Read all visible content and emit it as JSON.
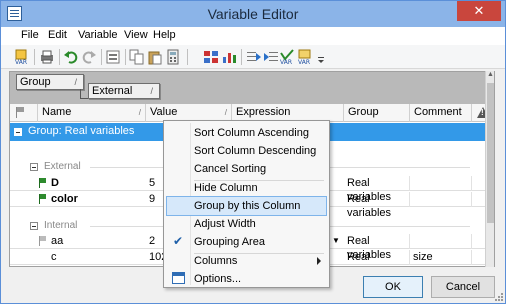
{
  "window": {
    "title": "Variable Editor",
    "close_glyph": "✕"
  },
  "menu": [
    "File",
    "Edit",
    "Variable",
    "View",
    "Help"
  ],
  "group_panel": {
    "chips": [
      "Group",
      "External"
    ],
    "sort_glyph": "/"
  },
  "columns": [
    "Name",
    "Value",
    "Expression",
    "Group",
    "Comment"
  ],
  "group_row": {
    "label": "Group: Real variables"
  },
  "subgroups": {
    "external": "External",
    "internal": "Internal"
  },
  "rows": [
    {
      "name": "D",
      "value": "5",
      "group": "Real variables",
      "comment": ""
    },
    {
      "name": "color",
      "value": "9",
      "group": "Real variables",
      "comment": ""
    },
    {
      "name": "aa",
      "value": "2",
      "group": "Real variables",
      "comment": ""
    },
    {
      "name": "c",
      "value": "102",
      "group": "Real variables",
      "comment": "size"
    }
  ],
  "context_menu": {
    "items": [
      "Sort Column Ascending",
      "Sort Column Descending",
      "Cancel Sorting",
      "Hide Column",
      "Group by this Column",
      "Adjust Width",
      "Grouping Area",
      "Columns",
      "Options..."
    ],
    "highlighted": "Group by this Column",
    "checked": "Grouping Area"
  },
  "buttons": {
    "ok": "OK",
    "cancel": "Cancel"
  },
  "colors": {
    "selection": "#3399e8",
    "titlebar": "#8bb4e8",
    "close": "#c9463d"
  },
  "icons": [
    "new-variable-icon",
    "print-icon",
    "undo-icon",
    "redo-icon",
    "copy-icon",
    "paste-icon",
    "expression-icon",
    "calculator-icon",
    "import-icon",
    "export-icon",
    "variable-icon",
    "dropdown-icon"
  ]
}
